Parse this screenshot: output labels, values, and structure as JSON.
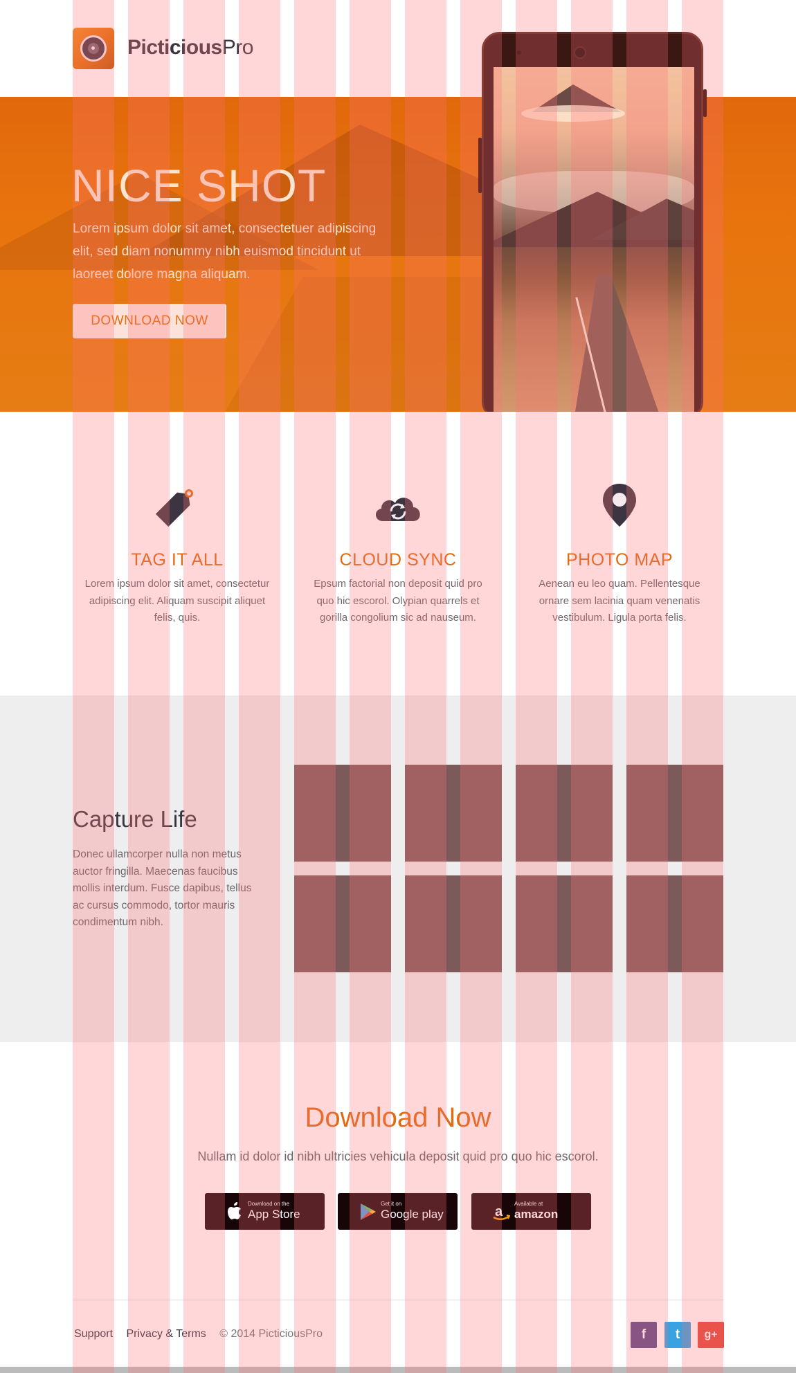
{
  "brand": {
    "name_bold": "Picticious",
    "name_light": "Pro"
  },
  "hero": {
    "title": "NICE SHOT",
    "text": "Lorem ipsum dolor sit amet, consectetuer adipiscing elit, sed diam nonummy nibh euismod tincidunt ut laoreet dolore magna aliquam.",
    "button_label": "DOWNLOAD NOW"
  },
  "features": [
    {
      "icon": "tag-icon",
      "title": "TAG IT ALL",
      "text": "Lorem ipsum dolor sit amet, consectetur adipiscing elit. Aliquam suscipit aliquet felis, quis."
    },
    {
      "icon": "cloud-sync-icon",
      "title": "CLOUD SYNC",
      "text": "Epsum factorial non deposit quid pro quo hic escorol. Olypian quarrels et gorilla congolium sic ad nauseum."
    },
    {
      "icon": "map-pin-icon",
      "title": "PHOTO MAP",
      "text": "Aenean eu leo quam. Pellentesque ornare sem lacinia quam venenatis vestibulum. Ligula porta felis."
    }
  ],
  "gallery": {
    "title": "Capture Life",
    "text": "Donec ullamcorper nulla non metus auctor fringilla. Maecenas faucibus mollis interdum. Fusce dapibus, tellus ac cursus commodo, tortor mauris condimentum nibh."
  },
  "download": {
    "title": "Download Now",
    "subtitle": "Nullam id dolor id nibh ultricies vehicula deposit quid pro quo hic escorol.",
    "stores": [
      {
        "small": "Download on the",
        "big": "App Store",
        "icon": "apple-icon"
      },
      {
        "small": "Get it on",
        "big": "Google play",
        "icon": "google-play-icon"
      },
      {
        "small": "Available at",
        "big": "amazon",
        "icon": "amazon-icon"
      }
    ]
  },
  "footer": {
    "support": "Support",
    "privacy": "Privacy & Terms",
    "copyright": "© 2014 PicticiousPro",
    "social": [
      {
        "icon": "facebook-icon",
        "glyph": "f",
        "color": "#5b4a8a"
      },
      {
        "icon": "twitter-icon",
        "glyph": "t",
        "color": "#3aa2e0"
      },
      {
        "icon": "google-plus-icon",
        "glyph": "g+",
        "color": "#e04a3c"
      }
    ]
  },
  "colors": {
    "accent": "#e3700f",
    "dark": "#3c3541",
    "gallery_tile": "#7d5a5a",
    "grid_overlay": "#ff6e78"
  }
}
